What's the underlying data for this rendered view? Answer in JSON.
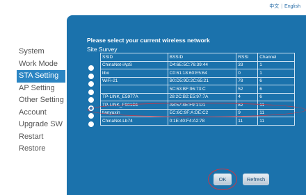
{
  "language_switch": {
    "chinese": "中文",
    "separator": "|",
    "english": "English"
  },
  "sidebar": {
    "items": [
      {
        "label": "System",
        "active": false
      },
      {
        "label": "Work Mode",
        "active": false
      },
      {
        "label": "STA Setting",
        "active": true
      },
      {
        "label": "AP Setting",
        "active": false
      },
      {
        "label": "Other Setting",
        "active": false
      },
      {
        "label": "Account",
        "active": false
      },
      {
        "label": "Upgrade SW",
        "active": false
      },
      {
        "label": "Restart",
        "active": false
      },
      {
        "label": "Restore",
        "active": false
      }
    ]
  },
  "main": {
    "title": "Please select your current wireless network",
    "survey_label": "Site Survey",
    "columns": [
      "SSID",
      "BSSID",
      "RSSI",
      "Channel"
    ],
    "rows": [
      {
        "ssid": "ChinaNet-iApS",
        "bssid": "D4:6E:5C:76:39:44",
        "rssi": "33",
        "channel": "1"
      },
      {
        "ssid": "libo",
        "bssid": "C0:61:18:60:E5:64",
        "rssi": "0",
        "channel": "1"
      },
      {
        "ssid": "WiFi-21",
        "bssid": "B0:D5:9D:2C:65:21",
        "rssi": "78",
        "channel": "6"
      },
      {
        "ssid": "",
        "bssid": "5C:63:BF:96:73:C",
        "rssi": "52",
        "channel": "6"
      },
      {
        "ssid": "TP-LINK_E5977A",
        "bssid": "28:2C:B2:E5:97:7A",
        "rssi": "4",
        "channel": "6"
      },
      {
        "ssid": "TP-LINK_F901D1",
        "bssid": "A8:57:4E:F9:1:D1",
        "rssi": "82",
        "channel": "11"
      },
      {
        "ssid": "tianyuxin",
        "bssid": "EC:6C:9F:A:DE:C2",
        "rssi": "9",
        "channel": "11"
      },
      {
        "ssid": "ChinaNet-Lb74",
        "bssid": "0:1E:40:F4:A2:78",
        "rssi": "11",
        "channel": "11"
      }
    ],
    "selected_row": 5,
    "buttons": {
      "ok": "OK",
      "refresh": "Refresh"
    }
  },
  "colors": {
    "panel": "#1b72ac",
    "nav_active": "#2b85c3",
    "annotation": "#c23a4a"
  }
}
